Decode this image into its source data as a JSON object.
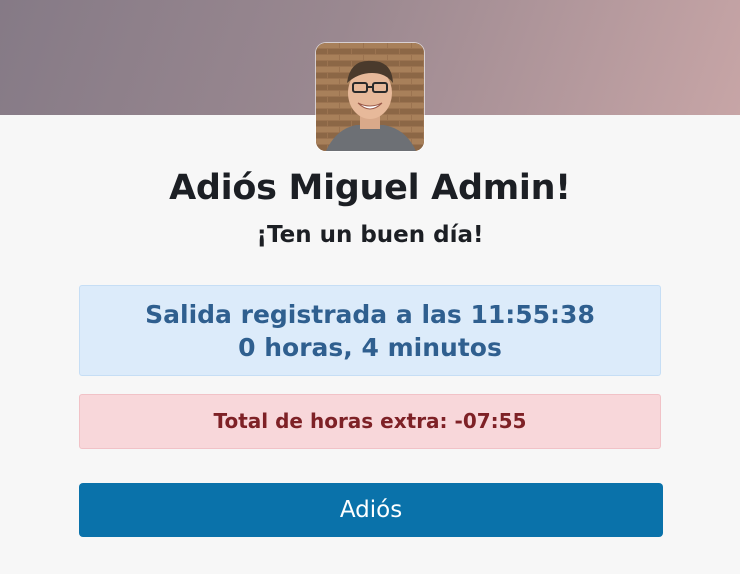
{
  "profile": {
    "avatar_alt": "Miguel Admin"
  },
  "greeting": {
    "title": "Adiós Miguel Admin!",
    "subtitle": "¡Ten un buen día!"
  },
  "checkout": {
    "line1": "Salida registrada a las 11:55:38",
    "line2": "0 horas, 4 minutos"
  },
  "overtime": {
    "text": "Total de horas extra: -07:55"
  },
  "actions": {
    "bye_label": "Adiós"
  },
  "colors": {
    "info_bg": "#dcebfa",
    "info_text": "#2f5f8f",
    "danger_bg": "#f8d7da",
    "danger_text": "#7e2126",
    "primary_button": "#0a72aa"
  }
}
